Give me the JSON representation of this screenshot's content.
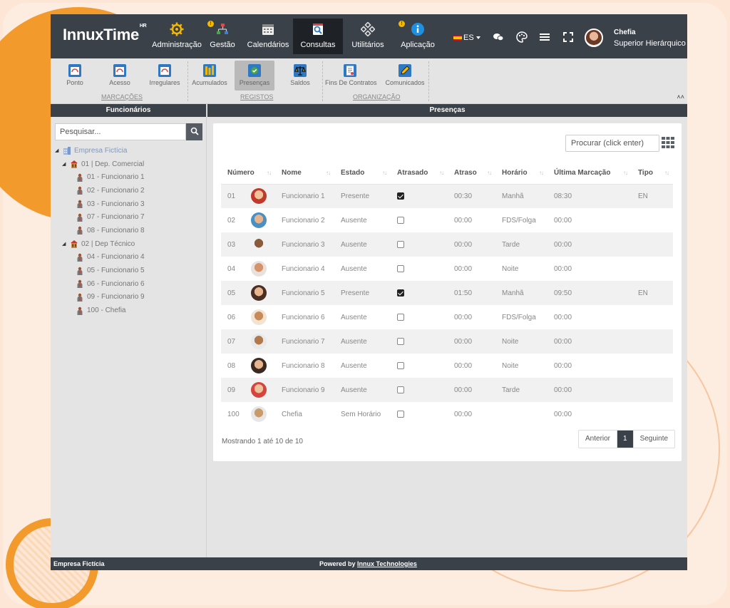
{
  "app": {
    "logo": "InnuxTime",
    "logo_sup": "HR"
  },
  "nav": [
    {
      "label": "Administração",
      "icon": "gear-icon",
      "badge": ""
    },
    {
      "label": "Gestão",
      "icon": "network-icon",
      "badge": "!"
    },
    {
      "label": "Calendários",
      "icon": "calendar-icon",
      "badge": ""
    },
    {
      "label": "Consultas",
      "icon": "search-doc-icon",
      "badge": "",
      "active": true
    },
    {
      "label": "Utilitários",
      "icon": "tools-icon",
      "badge": ""
    },
    {
      "label": "Aplicação",
      "icon": "info-icon",
      "badge": "!"
    }
  ],
  "topright": {
    "lang": "ES",
    "user_name": "Chefia",
    "user_role": "Superior Hierárquico"
  },
  "ribbon": {
    "buttons": [
      {
        "label": "Ponto"
      },
      {
        "label": "Acesso"
      },
      {
        "label": "Irregulares"
      },
      {
        "label": "Acumulados"
      },
      {
        "label": "Presenças",
        "active": true
      },
      {
        "label": "Saldos"
      },
      {
        "label": "Fins De Contratos"
      },
      {
        "label": "Comunicados"
      }
    ],
    "groups": [
      "MARCAÇÕES",
      "REGISTOS",
      "ORGANIZAÇÃO"
    ]
  },
  "left": {
    "title": "Funcionários",
    "search_placeholder": "Pesquisar...",
    "tree": {
      "root": "Empresa Fictícia",
      "dep1": "01 | Dep. Comercial",
      "dep1_items": [
        "01 - Funcionario 1",
        "02 - Funcionario 2",
        "03 - Funcionario 3",
        "07 - Funcionario 7",
        "08 - Funcionario 8"
      ],
      "dep2": "02 | Dep Técnico",
      "dep2_items": [
        "04 - Funcionario 4",
        "05 - Funcionario 5",
        "06 - Funcionario 6",
        "09 - Funcionario 9",
        "100 - Chefia"
      ]
    }
  },
  "right": {
    "title": "Presenças",
    "search_placeholder": "Procurar (click enter)",
    "columns": [
      "Número",
      "Nome",
      "Estado",
      "Atrasado",
      "Atraso",
      "Horário",
      "Última Marcação",
      "Tipo"
    ],
    "rows": [
      {
        "num": "01",
        "name": "Funcionario 1",
        "estado": "Presente",
        "atrasado": true,
        "atraso": "00:30",
        "horario": "Manhã",
        "ultima": "08:30",
        "tipo": "EN"
      },
      {
        "num": "02",
        "name": "Funcionario 2",
        "estado": "Ausente",
        "atrasado": false,
        "atraso": "00:00",
        "horario": "FDS/Folga",
        "ultima": "00:00",
        "tipo": ""
      },
      {
        "num": "03",
        "name": "Funcionario 3",
        "estado": "Ausente",
        "atrasado": false,
        "atraso": "00:00",
        "horario": "Tarde",
        "ultima": "00:00",
        "tipo": ""
      },
      {
        "num": "04",
        "name": "Funcionario 4",
        "estado": "Ausente",
        "atrasado": false,
        "atraso": "00:00",
        "horario": "Noite",
        "ultima": "00:00",
        "tipo": ""
      },
      {
        "num": "05",
        "name": "Funcionario 5",
        "estado": "Presente",
        "atrasado": true,
        "atraso": "01:50",
        "horario": "Manhã",
        "ultima": "09:50",
        "tipo": "EN"
      },
      {
        "num": "06",
        "name": "Funcionario 6",
        "estado": "Ausente",
        "atrasado": false,
        "atraso": "00:00",
        "horario": "FDS/Folga",
        "ultima": "00:00",
        "tipo": ""
      },
      {
        "num": "07",
        "name": "Funcionario 7",
        "estado": "Ausente",
        "atrasado": false,
        "atraso": "00:00",
        "horario": "Noite",
        "ultima": "00:00",
        "tipo": ""
      },
      {
        "num": "08",
        "name": "Funcionario 8",
        "estado": "Ausente",
        "atrasado": false,
        "atraso": "00:00",
        "horario": "Noite",
        "ultima": "00:00",
        "tipo": ""
      },
      {
        "num": "09",
        "name": "Funcionario 9",
        "estado": "Ausente",
        "atrasado": false,
        "atraso": "00:00",
        "horario": "Tarde",
        "ultima": "00:00",
        "tipo": ""
      },
      {
        "num": "100",
        "name": "Chefia",
        "estado": "Sem Horário",
        "atrasado": false,
        "atraso": "00:00",
        "horario": "",
        "ultima": "00:00",
        "tipo": ""
      }
    ],
    "showing": "Mostrando 1 até 10 de 10",
    "pager": {
      "prev": "Anterior",
      "current": "1",
      "next": "Seguinte"
    }
  },
  "footer": {
    "left": "Empresa Fictícia",
    "powered": "Powered by ",
    "link": "Innux Technologies"
  },
  "colors": {
    "topbar": "#3a4149",
    "accent_orange": "#f39a2c",
    "badge_yellow": "#f5b800"
  }
}
